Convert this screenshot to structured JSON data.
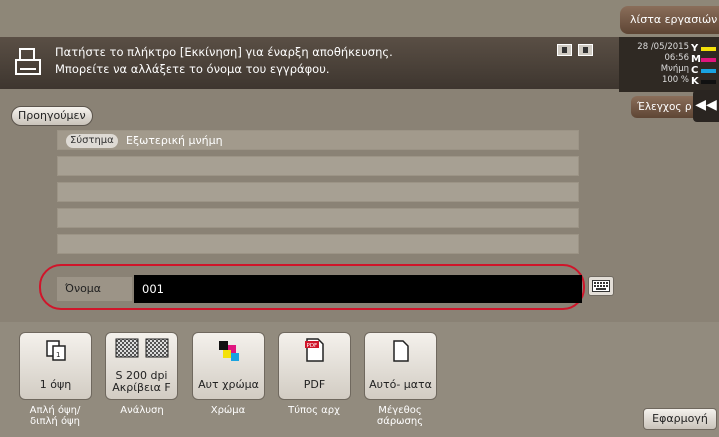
{
  "header": {
    "job_list_label": "λίστα εργασιών",
    "message_line1": "Πατήστε το πλήκτρο [Εκκίνηση] για έναρξη αποθήκευσης.",
    "message_line2": "Μπορείτε να αλλάξετε το όνομα του εγγράφου.",
    "check_label": "Έλεγχος ρ",
    "collapse_glyph": "◀◀"
  },
  "status": {
    "date": "28 /05/2015",
    "time": "06:56",
    "memory_label": "Μνήμη",
    "memory_value": "100 %",
    "toners": [
      {
        "letter": "Y",
        "color": "#f4e10a"
      },
      {
        "letter": "M",
        "color": "#e0157f"
      },
      {
        "letter": "C",
        "color": "#1aa3e0"
      },
      {
        "letter": "K",
        "color": "#111111"
      }
    ]
  },
  "nav": {
    "prev_label": "Προηγούμεν"
  },
  "destination": {
    "badge": "Σύστημα",
    "path": "Εξωτερική μνήμη"
  },
  "name_field": {
    "label": "Όνομα",
    "value": "001"
  },
  "functions": [
    {
      "id": "simplex",
      "value": "1 όψη",
      "caption": "Απλή όψη/\nδιπλή όψη"
    },
    {
      "id": "resolution",
      "value": "S 200 dpi\nΑκρίβεια F",
      "caption": "Ανάλυση"
    },
    {
      "id": "color",
      "value": "Αυτ χρώμα",
      "caption": "Χρώμα"
    },
    {
      "id": "filetype",
      "value": "PDF",
      "caption": "Τύπος αρχ"
    },
    {
      "id": "scansize",
      "value": "Αυτό- ματα",
      "caption": "Μέγεθος\nσάρωσης"
    }
  ],
  "apply_label": "Εφαρμογή",
  "icons": {
    "printer": "printer-icon",
    "keyboard": "keyboard-icon",
    "pdf_badge": "PDF"
  }
}
